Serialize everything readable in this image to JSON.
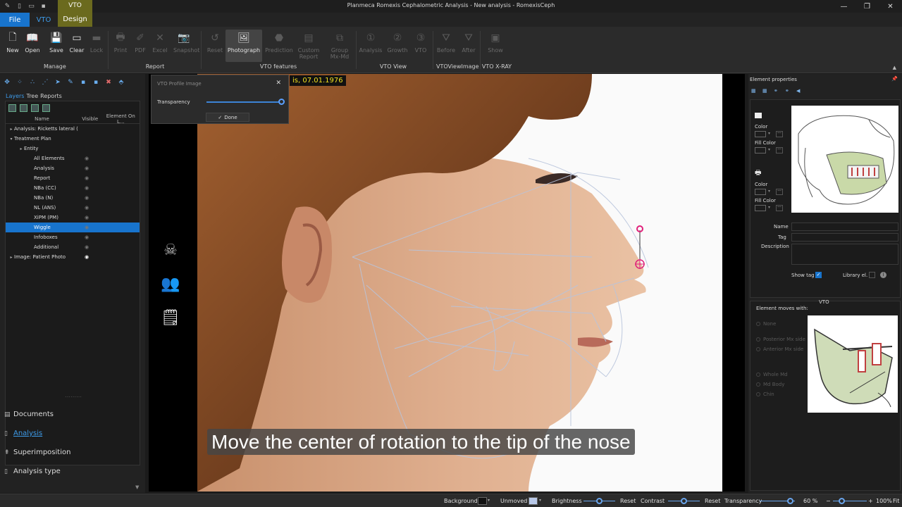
{
  "window": {
    "title": "Planmeca Romexis Cephalometric Analysis - New analysis - RomexisCeph"
  },
  "tabs": {
    "file": "File",
    "vto": "VTO",
    "design_context": "VTO",
    "design": "Design"
  },
  "ribbon": {
    "new": "New",
    "open": "Open",
    "save": "Save",
    "clear": "Clear",
    "lock": "Lock",
    "manage": "Manage",
    "print": "Print",
    "pdf": "PDF",
    "excel": "Excel",
    "snapshot": "Snapshot",
    "report": "Report",
    "reset": "Reset",
    "photograph": "Photograph",
    "prediction": "Prediction",
    "custom_report_1": "Custom",
    "custom_report_2": "Report",
    "group_1": "Group",
    "group_2": "Mx-Md",
    "vto_features": "VTO features",
    "analysis": "Analysis",
    "growth": "Growth",
    "vto": "VTO",
    "vto_view": "VTO View",
    "before": "Before",
    "after": "After",
    "vto_view_image": "VTOViewImage",
    "show": "Show",
    "vto_xray": "VTO X-RAY"
  },
  "left_panel": {
    "tab_layers": "Layers",
    "tab_tree": "Tree",
    "tab_reports": "Reports",
    "col_name": "Name",
    "col_visible": "Visible",
    "col_element": "Element On L...",
    "rows": [
      {
        "label": "Analysis: Ricketts lateral (",
        "indent": 0,
        "expander": "▸"
      },
      {
        "label": "Treatment Plan",
        "indent": 0,
        "expander": "▾"
      },
      {
        "label": "Entity",
        "indent": 1,
        "expander": "▸"
      },
      {
        "label": "All Elements",
        "indent": 2,
        "expander": ""
      },
      {
        "label": "Analysis",
        "indent": 2,
        "expander": ""
      },
      {
        "label": "Report",
        "indent": 2,
        "expander": ""
      },
      {
        "label": "NBa (CC)",
        "indent": 2,
        "expander": ""
      },
      {
        "label": "NBa (N)",
        "indent": 2,
        "expander": ""
      },
      {
        "label": "NL (ANS)",
        "indent": 2,
        "expander": ""
      },
      {
        "label": "XiPM (PM)",
        "indent": 2,
        "expander": ""
      },
      {
        "label": "Wiggle",
        "indent": 2,
        "expander": ""
      },
      {
        "label": "Infoboxes",
        "indent": 2,
        "expander": ""
      },
      {
        "label": "Additional",
        "indent": 2,
        "expander": ""
      },
      {
        "label": "Image: Patient Photo",
        "indent": 0,
        "expander": "▸"
      }
    ],
    "nav": [
      "Documents",
      "Analysis",
      "Superimposition",
      "Analysis type"
    ]
  },
  "canvas": {
    "patient_label": "is, 07.01.1976",
    "caption": "Move the center of rotation to the tip of the nose",
    "dialog_title": "VTO Profile Image",
    "transparency_label": "Transparency",
    "transparency_value": 0.98,
    "done_label": "Done"
  },
  "right_panel": {
    "title": "Element properties",
    "color": "Color",
    "fill_color": "Fill Color",
    "name": "Name",
    "tag": "Tag",
    "description": "Description",
    "show_tag": "Show tag",
    "library_el": "Library el.",
    "moves_title": "Element moves with:",
    "vto_tag": "VTO",
    "moves_options": [
      "None",
      "Posterior Mx side",
      "Anterior Mx side",
      "Whole Md",
      "Md Body",
      "Chin"
    ]
  },
  "status": {
    "background": "Background",
    "unmoved": "Unmoved",
    "brightness": "Brightness",
    "reset1": "Reset",
    "contrast": "Contrast",
    "reset2": "Reset",
    "transparency": "Transparency",
    "transparency_pct": "60 %",
    "zoom_minus": "−",
    "zoom_plus": "+",
    "zoom": "100%",
    "fit": "Fit"
  },
  "colors": {
    "accent": "#1874cd",
    "link": "#3d9be9",
    "design_tab": "#6b6a1e",
    "patient_text": "#f0e020",
    "marker": "#e0207a"
  }
}
